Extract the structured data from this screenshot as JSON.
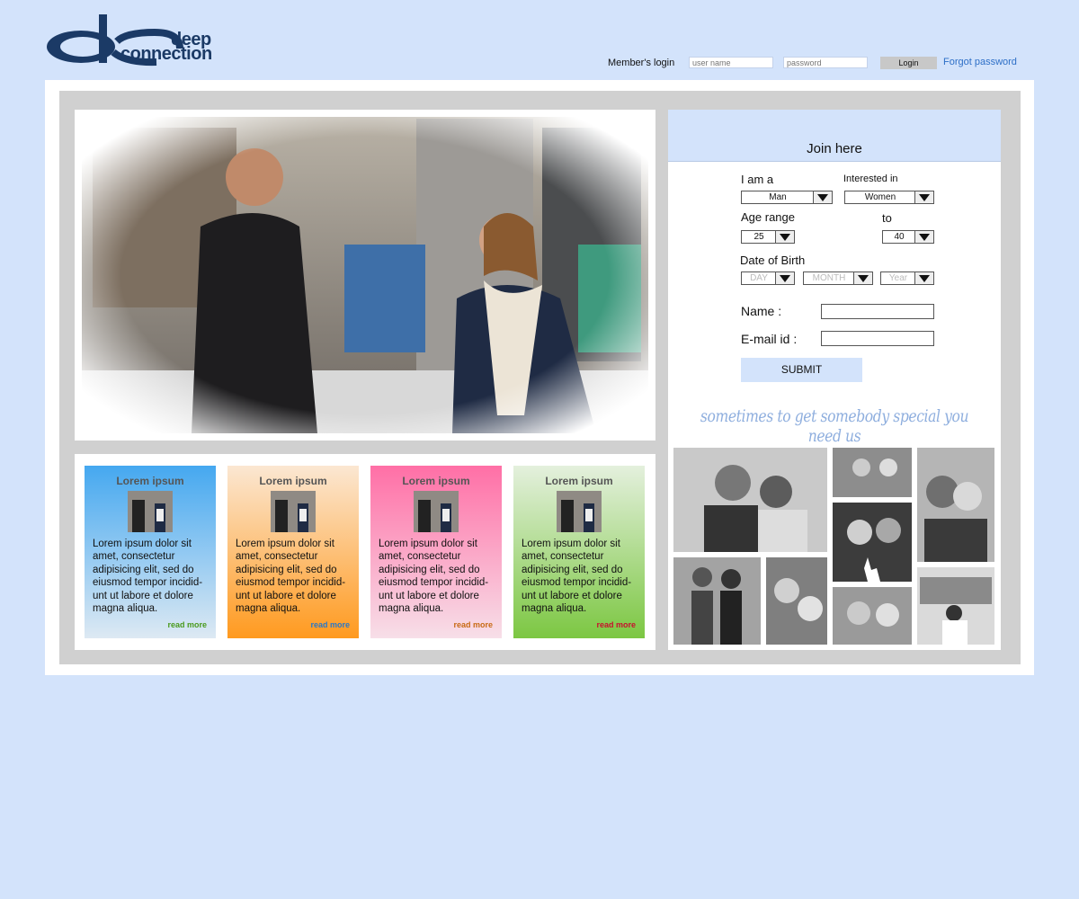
{
  "brand": {
    "line1": "deep",
    "line2": "connection"
  },
  "login": {
    "label": "Member's login",
    "username_placeholder": "user name",
    "password_placeholder": "password",
    "button": "Login",
    "forgot": "Forgot password"
  },
  "cards": [
    {
      "title": "Lorem ipsum",
      "body": "Lorem ipsum dolor sit amet, consectetur adipisicing elit, sed do eiusmod tempor incidid-unt ut labore et dolore magna aliqua.",
      "more": "read more",
      "more_color": "#4a9a1e"
    },
    {
      "title": "Lorem ipsum",
      "body": "Lorem ipsum dolor sit amet, consectetur adipisicing elit, sed do eiusmod tempor incidid-unt ut labore et dolore magna aliqua.",
      "more": "read more",
      "more_color": "#2a78c8"
    },
    {
      "title": "Lorem ipsum",
      "body": "Lorem ipsum dolor sit amet, consectetur adipisicing elit, sed do eiusmod tempor incidid-unt ut labore et dolore magna aliqua.",
      "more": "read more",
      "more_color": "#c86a14"
    },
    {
      "title": "Lorem ipsum",
      "body": "Lorem ipsum dolor sit amet, consectetur adipisicing elit, sed do eiusmod tempor incidid-unt ut labore et dolore magna aliqua.",
      "more": "read more",
      "more_color": "#c8102e"
    }
  ],
  "join": {
    "title": "Join here",
    "i_am_label": "I am a",
    "i_am_value": "Man",
    "interested_label": "Interested in",
    "interested_value": "Women",
    "age_label": "Age range",
    "age_to_label": "to",
    "age_from": "25",
    "age_to": "40",
    "dob_label": "Date of Birth",
    "dob_day": "DAY",
    "dob_month": "MONTH",
    "dob_year": "Year",
    "name_label": "Name :",
    "email_label": "E-mail id :",
    "submit": "SUBMIT",
    "tagline": "sometimes to get somebody special you need us"
  },
  "colors": {
    "page_bg": "#d3e3fb",
    "link_blue": "#2d6fc7",
    "card_blue": "#45a8f0",
    "card_orange": "#ff9a1f",
    "card_pink": "#ff6fa6",
    "card_green": "#7cc742"
  }
}
